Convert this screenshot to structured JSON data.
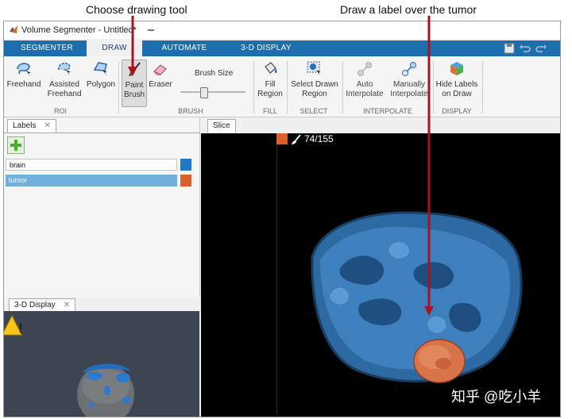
{
  "callouts": {
    "left": "Choose drawing tool",
    "right": "Draw a label over the tumor"
  },
  "window": {
    "title": "Volume Segmenter - Untitled*"
  },
  "tabs": [
    {
      "label": "SEGMENTER",
      "active": false
    },
    {
      "label": "DRAW",
      "active": true
    },
    {
      "label": "AUTOMATE",
      "active": false
    },
    {
      "label": "3-D DISPLAY",
      "active": false
    }
  ],
  "ribbon": {
    "freehand": "Freehand",
    "assisted_freehand_1": "Assisted",
    "assisted_freehand_2": "Freehand",
    "polygon": "Polygon",
    "paint_brush_1": "Paint",
    "paint_brush_2": "Brush",
    "eraser": "Eraser",
    "brush_size": "Brush Size",
    "brush_size_value": 0.35,
    "fill_region_1": "Fill",
    "fill_region_2": "Region",
    "select_drawn_1": "Select Drawn",
    "select_drawn_2": "Region",
    "auto_interp_1": "Auto",
    "auto_interp_2": "Interpolate",
    "manual_interp_1": "Manually",
    "manual_interp_2": "Interpolate",
    "hide_labels_1": "Hide Labels",
    "hide_labels_2": "on Draw",
    "groups": {
      "roi": "ROI",
      "brush": "BRUSH",
      "fill": "FILL",
      "select": "SELECT",
      "interpolate": "INTERPOLATE",
      "display": "DISPLAY"
    }
  },
  "labels_panel": {
    "tab": "Labels",
    "close": "✕",
    "items": [
      {
        "name": "brain",
        "color": "#1f78c8",
        "selected": false
      },
      {
        "name": "tumor",
        "color": "#d95f2b",
        "selected": true
      }
    ]
  },
  "slice_panel": {
    "tab": "Slice",
    "counter": "74/155",
    "label_color": "#d95f2b"
  },
  "display3d_panel": {
    "tab": "3-D Display",
    "close": "✕"
  },
  "watermark": "知乎 @吃小羊",
  "colors": {
    "accent": "#1c6fae",
    "brain": "#1f78c8",
    "tumor": "#d95f2b",
    "arrow": "#a6141c"
  }
}
